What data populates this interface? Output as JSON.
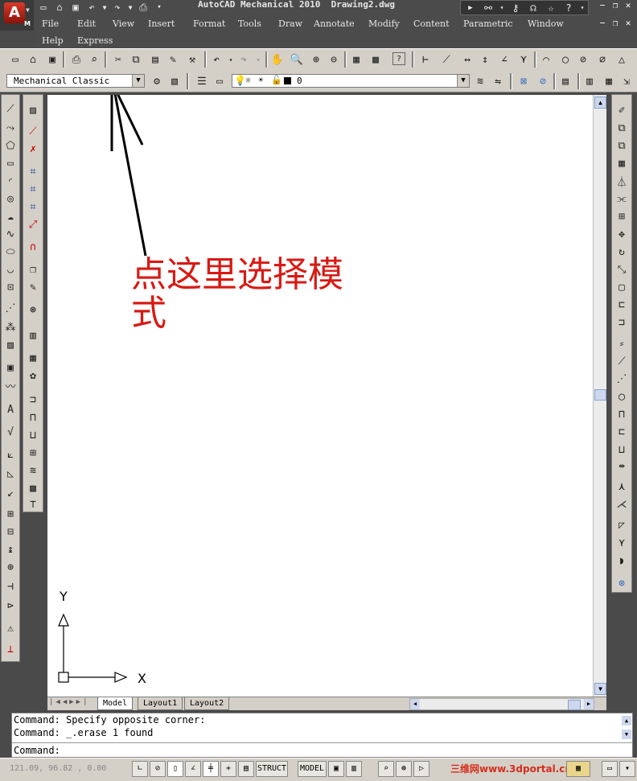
{
  "window": {
    "title": "AutoCAD Mechanical 2010  Drawing2.dwg",
    "logo_letter": "A",
    "logo_badge": "M"
  },
  "menu": {
    "items": [
      "File",
      "Edit",
      "View",
      "Insert",
      "Format",
      "Tools",
      "Draw",
      "Annotate",
      "Modify",
      "Content",
      "Parametric",
      "Window",
      "Help",
      "Express"
    ]
  },
  "workspace": {
    "selected": "Mechanical Classic"
  },
  "layer": {
    "current": "0"
  },
  "annotation": {
    "text": "点这里选择模式",
    "color": "#d81a14"
  },
  "ucs": {
    "x_label": "X",
    "y_label": "Y"
  },
  "layout_tabs": [
    "Model",
    "Layout1",
    "Layout2"
  ],
  "command": {
    "history": [
      "Command: Specify opposite corner:",
      "Command: _.erase 1 found"
    ],
    "prompt": "Command:"
  },
  "status": {
    "coordinates": "121.09, 96.82 , 0.00",
    "struct_label": "STRUCT",
    "model_label": "MODEL"
  },
  "watermark": "三维网www.3dportal.cn"
}
